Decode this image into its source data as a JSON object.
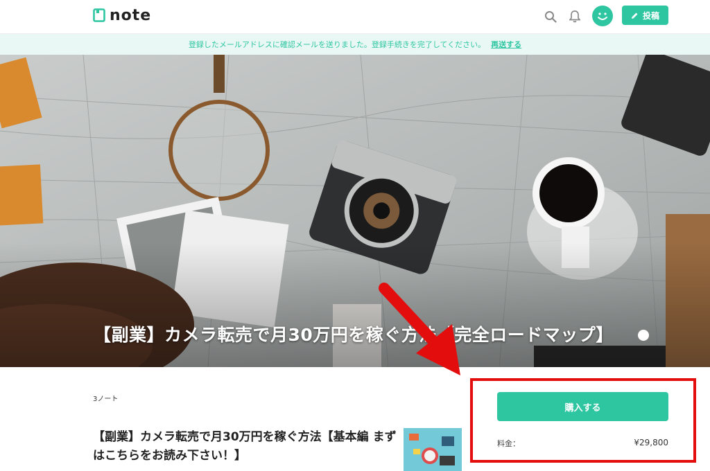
{
  "header": {
    "logo_text": "note",
    "post_label": "投稿",
    "icons": [
      "search-icon",
      "bell-icon",
      "avatar-icon",
      "pencil-icon"
    ],
    "accent": "#2ec6a1"
  },
  "notice": {
    "message": "登録したメールアドレスに確認メールを送りました。登録手続きを完了してください。",
    "resend_label": "再送する"
  },
  "hero": {
    "title": "【副業】カメラ転売で月30万円を稼ぐ方法【完全ロードマップ】"
  },
  "magazine": {
    "count_label": "3ノート"
  },
  "article": {
    "title": "【副業】カメラ転売で月30万円を稼ぐ方法【基本編 まずはこちらをお読み下さい！】"
  },
  "purchase": {
    "button_label": "購入する",
    "price_label": "料金：",
    "price_value": "¥29,800",
    "highlight_color": "#e30d0d"
  }
}
